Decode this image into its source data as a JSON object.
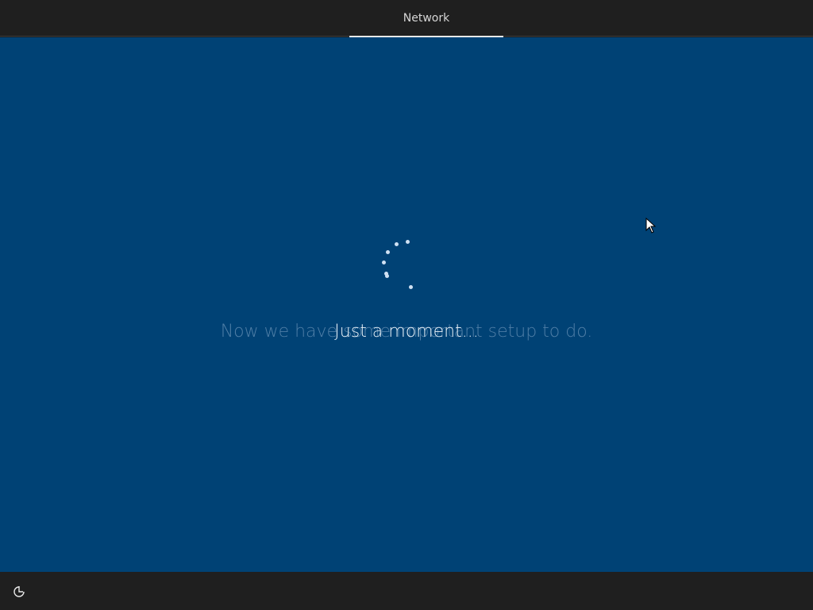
{
  "header": {
    "tabs": [
      {
        "label": "Network",
        "active": true
      }
    ]
  },
  "main": {
    "background_text": "Now we have some important setup to do.",
    "status_text": "Just a moment..."
  },
  "footer": {
    "icon": "ease-of-access-icon"
  },
  "colors": {
    "background": "#004275",
    "bars": "#1f1f1f",
    "text": "#e8f0f7",
    "faded_text": "#4f7ea6"
  }
}
